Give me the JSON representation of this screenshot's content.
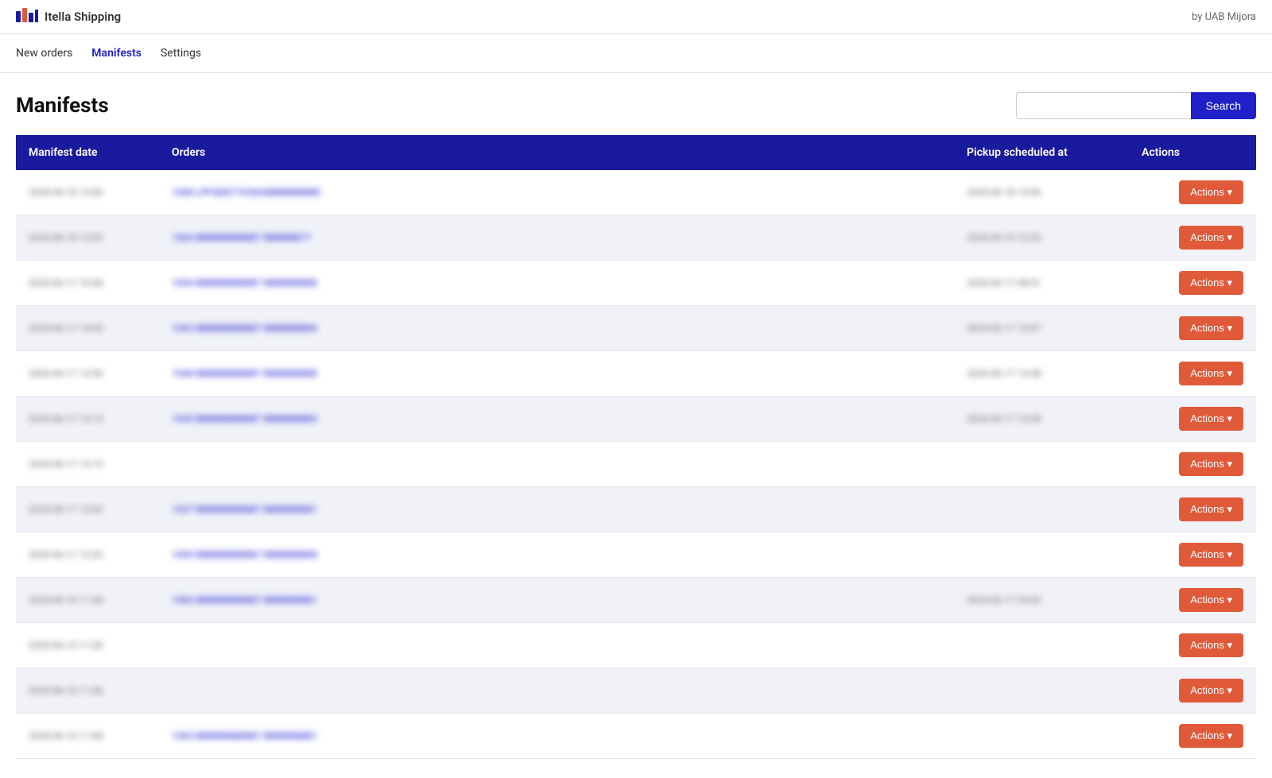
{
  "header": {
    "brand": "Itella Shipping",
    "by": "by UAB Mijora"
  },
  "nav": {
    "items": [
      {
        "label": "New orders",
        "active": false
      },
      {
        "label": "Manifests",
        "active": true
      },
      {
        "label": "Settings",
        "active": false
      }
    ]
  },
  "page": {
    "title": "Manifests",
    "search_placeholder": "",
    "search_button": "Search"
  },
  "table": {
    "columns": [
      {
        "label": "Manifest date"
      },
      {
        "label": "Orders"
      },
      {
        "label": "Pickup scheduled at"
      },
      {
        "label": "Actions"
      }
    ],
    "rows": [
      {
        "date": "2020-06-18 13:06",
        "order_id": "1068",
        "order_text": "LPFQ8GT7G36GBBBBBBBBB",
        "pickup": "2020-06-18 13:06",
        "has_pickup": true
      },
      {
        "date": "2020-06-18 13:03",
        "order_id": "1064",
        "order_text": "BBBBBBBBBB7 BBBBBB77",
        "pickup": "2020-06-18 13:03",
        "has_pickup": true
      },
      {
        "date": "2020-06-17 16:08",
        "order_id": "1054",
        "order_text": "BBBBBBBBBB7 BBBBBBBB8",
        "pickup": "2020-06-17 08:01",
        "has_pickup": true
      },
      {
        "date": "2020-06-17 15:45",
        "order_id": "1053",
        "order_text": "BBBBBBBBBB7 BBBBBBBB6",
        "pickup": "2020-06-17 15:07",
        "has_pickup": true
      },
      {
        "date": "2020-06-17 14:56",
        "order_id": "1048",
        "order_text": "BBBBBBBBBB7 BBBBBBBB8",
        "pickup": "2020-06-17 14:48",
        "has_pickup": true
      },
      {
        "date": "2020-06-17 13:14",
        "order_id": "1045",
        "order_text": "BBBBBBBBBB7 BBBBBBBB3",
        "pickup": "2020-06-17 13:08",
        "has_pickup": true
      },
      {
        "date": "2020-06-17 13:19",
        "order_id": "",
        "order_text": "",
        "pickup": "",
        "has_pickup": false
      },
      {
        "date": "2020-06-17 13:02",
        "order_id": "1037",
        "order_text": "BBBBBBBBBB7 BBBBBBBB1",
        "pickup": "",
        "has_pickup": false
      },
      {
        "date": "2020-06-17 13:26",
        "order_id": "1009",
        "order_text": "BBBBBBBBBB7 BBBBBBBB8",
        "pickup": "",
        "has_pickup": false
      },
      {
        "date": "2020-06-10 11:06",
        "order_id": "1006",
        "order_text": "BBBBBBBBBB7 BBBBBBBB1",
        "pickup": "2020-06-17 23:03",
        "has_pickup": true
      },
      {
        "date": "2020-06-10 11:06",
        "order_id": "",
        "order_text": "",
        "pickup": "",
        "has_pickup": false
      },
      {
        "date": "2020-06-10 11:06",
        "order_id": "",
        "order_text": "",
        "pickup": "",
        "has_pickup": false
      },
      {
        "date": "2020-06-10 11:08",
        "order_id": "1003",
        "order_text": "BBBBBBBBBB7 BBBBBBBB1",
        "pickup": "",
        "has_pickup": false
      }
    ],
    "actions_label": "Actions ▾"
  }
}
